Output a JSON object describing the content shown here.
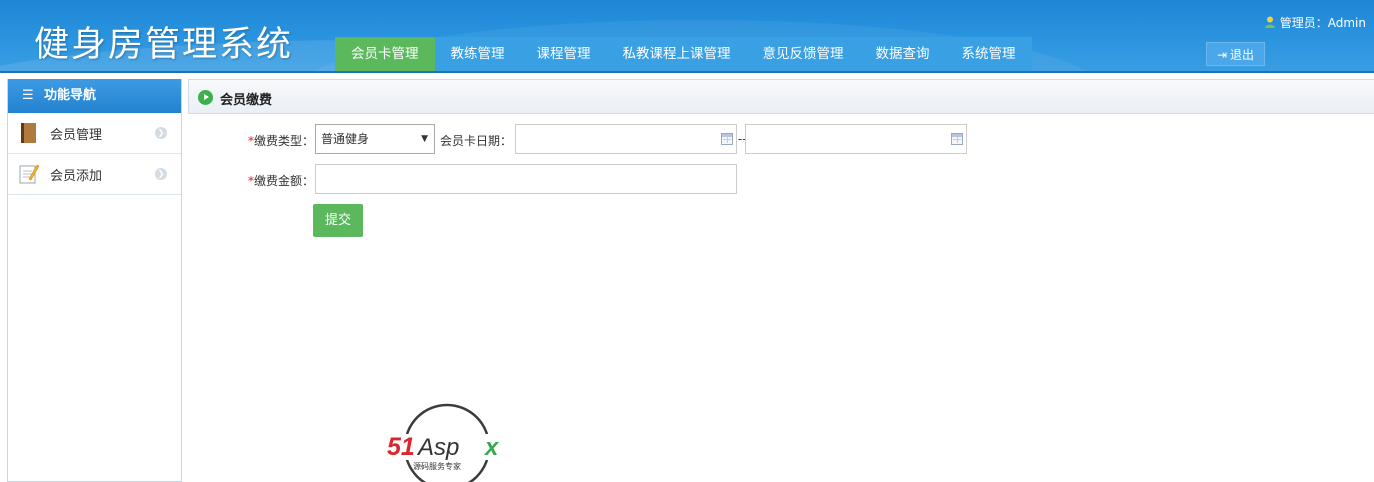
{
  "app": {
    "title": "健身房管理系统"
  },
  "top_nav": {
    "items": [
      {
        "label": "会员卡管理",
        "active": true
      },
      {
        "label": "教练管理",
        "active": false
      },
      {
        "label": "课程管理",
        "active": false
      },
      {
        "label": "私教课程上课管理",
        "active": false
      },
      {
        "label": "意见反馈管理",
        "active": false
      },
      {
        "label": "数据查询",
        "active": false
      },
      {
        "label": "系统管理",
        "active": false
      }
    ],
    "active_color": "#5cb85c"
  },
  "user": {
    "label": "管理员：Admin",
    "icon": "user-icon"
  },
  "logout": {
    "label": "退出",
    "icon": "logout-icon"
  },
  "sidebar": {
    "header": "功能导航",
    "header_icon": "list-icon",
    "items": [
      {
        "label": "会员管理",
        "icon": "book-icon"
      },
      {
        "label": "会员添加",
        "icon": "edit-note-icon"
      }
    ]
  },
  "main": {
    "title": "会员缴费",
    "title_icon": "play-circle-icon",
    "form": {
      "required_mark": "*",
      "fee_type_label": "缴费类型：",
      "fee_type_value": "普通健身",
      "card_date_label": "会员卡日期：",
      "date_start_value": "",
      "date_end_value": "",
      "date_separator": "--",
      "amount_label": "缴费金额：",
      "amount_value": "",
      "submit_label": "提交"
    }
  },
  "watermark": {
    "brand": "51Aspx",
    "tagline": "源码服务专家"
  },
  "colors": {
    "header_blue": "#2b95e0",
    "accent_green": "#5cb85c",
    "required_red": "#e02020"
  }
}
